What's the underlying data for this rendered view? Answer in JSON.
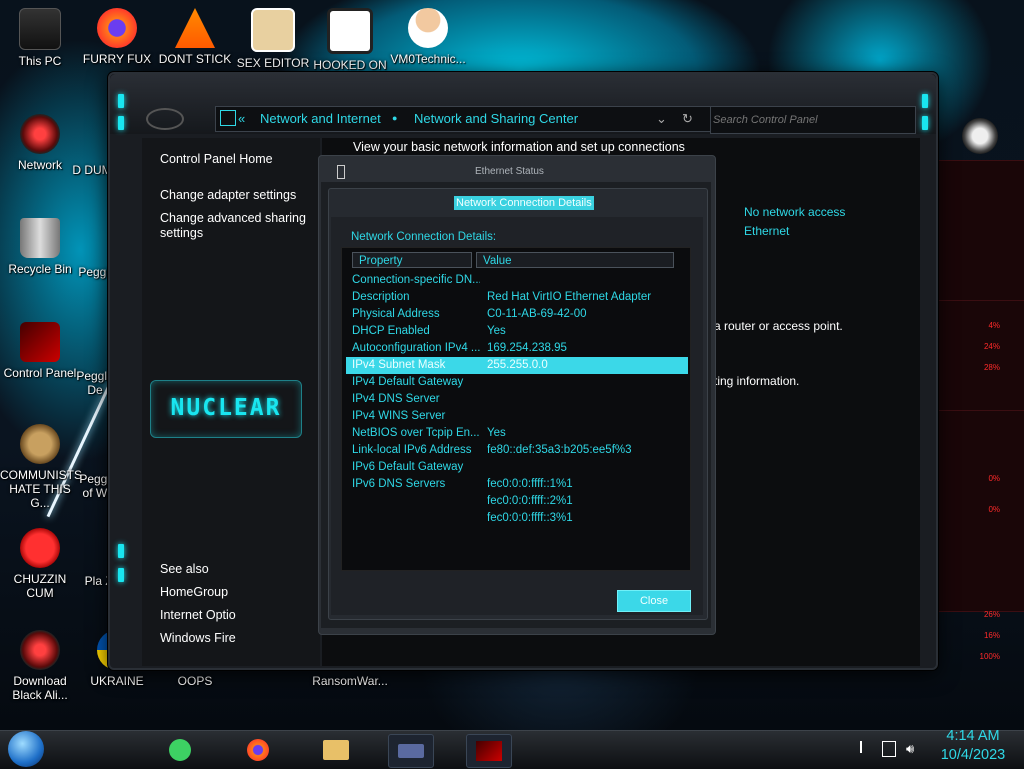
{
  "desktop": {
    "icons": [
      {
        "label": "This PC"
      },
      {
        "label": "FURRY FUX"
      },
      {
        "label": "DONT STICK"
      },
      {
        "label": "SEX EDITOR"
      },
      {
        "label": "HOOKED ON"
      },
      {
        "label": "VM0Technic..."
      },
      {
        "label": "Network"
      },
      {
        "label": "Recycle Bin"
      },
      {
        "label": "Control Panel"
      },
      {
        "label": "COMMUNISTS HATE THIS G..."
      },
      {
        "label": "CHUZZIN CUM"
      },
      {
        "label": "Download Black Ali..."
      },
      {
        "label": "UKRAINE"
      },
      {
        "label": "OOPS"
      },
      {
        "label": "RansomWar..."
      },
      {
        "label": "D DUM"
      },
      {
        "label": "Peggle"
      },
      {
        "label": "Peggle De"
      },
      {
        "label": "Peggle of Wa"
      },
      {
        "label": "Pla Zo"
      }
    ]
  },
  "control_panel": {
    "breadcrumb": {
      "back_glyph": "«",
      "item1": "Network and Internet",
      "separator": "●",
      "item2": "Network and Sharing Center",
      "dropdown_glyph": "⌄",
      "refresh_glyph": "↻"
    },
    "search_placeholder": "Search Control Panel",
    "sidebar": {
      "home": "Control Panel Home",
      "adapter": "Change adapter settings",
      "advanced_line1": "Change advanced sharing",
      "advanced_line2": "settings",
      "logo": "NUCLEAR",
      "see_also": "See also",
      "homegroup": "HomeGroup",
      "internet_options": "Internet Optio",
      "firewall": "Windows Fire"
    },
    "content": {
      "heading": "View your basic network information and set up connections",
      "access": "No network access",
      "connection": "Ethernet",
      "frag1": "a router or access point.",
      "frag2": "ting information."
    }
  },
  "ethernet_status": {
    "title": "Ethernet Status"
  },
  "details_dialog": {
    "title": "Network Connection Details",
    "section_label": "Network Connection Details:",
    "columns": {
      "property": "Property",
      "value": "Value"
    },
    "rows": [
      {
        "property": "Connection-specific DN...",
        "value": ""
      },
      {
        "property": "Description",
        "value": "Red Hat VirtIO Ethernet Adapter"
      },
      {
        "property": "Physical Address",
        "value": "C0-11-AB-69-42-00"
      },
      {
        "property": "DHCP Enabled",
        "value": "Yes"
      },
      {
        "property": "Autoconfiguration IPv4 ...",
        "value": "169.254.238.95"
      },
      {
        "property": "IPv4 Subnet Mask",
        "value": "255.255.0.0",
        "selected": true
      },
      {
        "property": "IPv4 Default Gateway",
        "value": ""
      },
      {
        "property": "IPv4 DNS Server",
        "value": ""
      },
      {
        "property": "IPv4 WINS Server",
        "value": ""
      },
      {
        "property": "NetBIOS over Tcpip En...",
        "value": "Yes"
      },
      {
        "property": "Link-local IPv6 Address",
        "value": "fe80::def:35a3:b205:ee5f%3"
      },
      {
        "property": "IPv6 Default Gateway",
        "value": ""
      },
      {
        "property": "IPv6 DNS Servers",
        "value": "fec0:0:0:ffff::1%1"
      },
      {
        "property": "",
        "value": "fec0:0:0:ffff::2%1"
      },
      {
        "property": "",
        "value": "fec0:0:0:ffff::3%1"
      }
    ],
    "close_label": "Close"
  },
  "right_widget": {
    "values": [
      "4%",
      "24%",
      "28%",
      "0%",
      "0%",
      "26%",
      "16%",
      "100%"
    ]
  },
  "taskbar": {
    "time": "4:14 AM",
    "date": "10/4/2023",
    "tray_icons": [
      "flag-icon",
      "network-icon",
      "speaker-icon"
    ]
  },
  "colors": {
    "accent": "#2fd8e6",
    "selection": "#3bd8e8",
    "danger": "#ff2a2a"
  }
}
